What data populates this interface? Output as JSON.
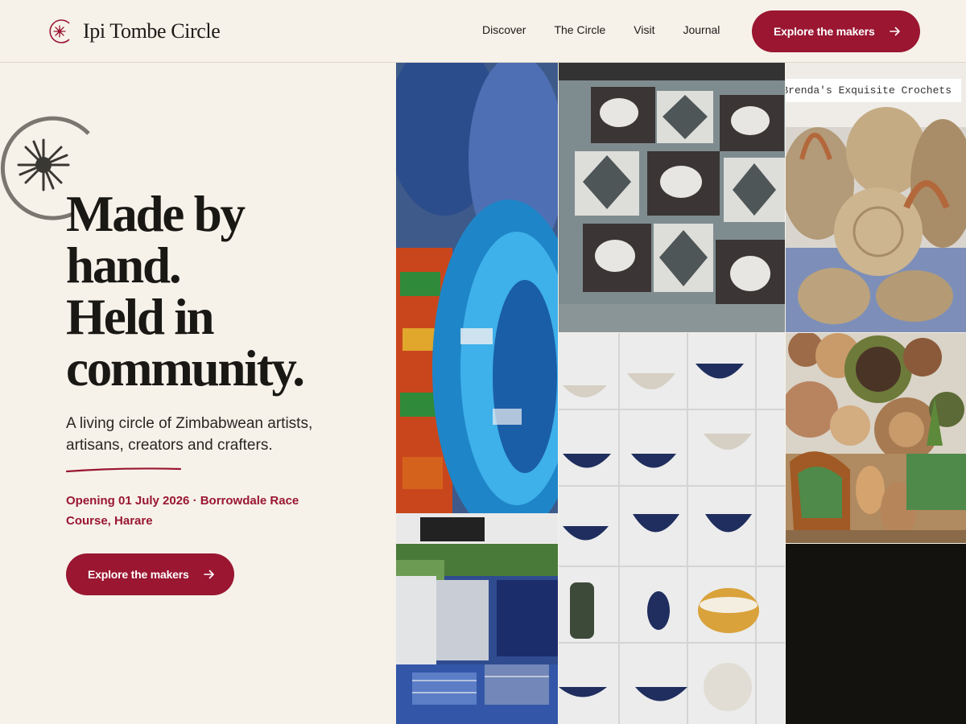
{
  "brand": {
    "name": "Ipi Tombe Circle",
    "logo_icon": "sunburst-circle-icon",
    "accent": "#9a1631"
  },
  "nav": {
    "items": [
      "Discover",
      "The Circle",
      "Visit",
      "Journal"
    ],
    "cta_label": "Explore the makers"
  },
  "hero": {
    "title_lines": [
      "Made by",
      "hand.",
      "Held in",
      "community."
    ],
    "subtitle": "A living circle of Zimbabwean artists, artisans, creators and crafters.",
    "event": "Opening 01 July 2026 · Borrowdale Race Course, Harare",
    "cta_label": "Explore the makers",
    "decor_icon": "sunburst-circle-icon"
  },
  "gallery": {
    "tile_label": "Brenda's Exquisite Crochets",
    "images": [
      "rolled-printed-fabrics-photo",
      "elephant-print-textile-photo",
      "crochet-bags-photo",
      "woven-textiles-market-photo",
      "ceramic-bowls-shelves-photo",
      "woven-baskets-wall-photo"
    ]
  }
}
